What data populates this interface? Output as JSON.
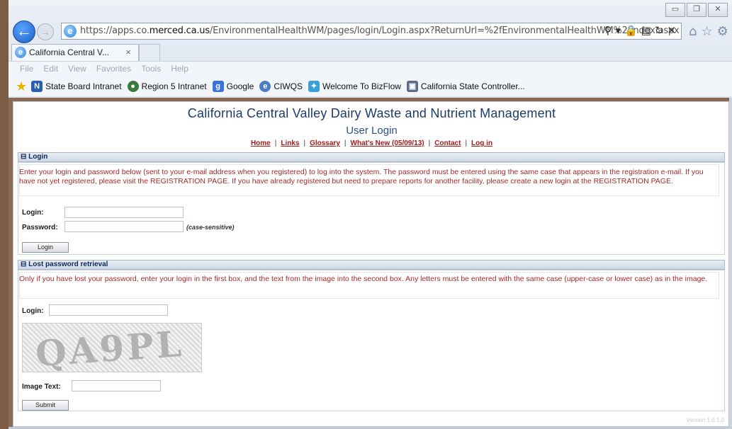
{
  "browser": {
    "url_prefix": "https://apps.co.",
    "url_host": "merced.ca.us",
    "url_path": "/EnvironmentalHealthWM/pages/login/Login.aspx?ReturnUrl=%2fEnvironmentalHealthWM%2findex.aspx",
    "tab_title": "California Central V...",
    "tab_close": "×",
    "menu": [
      "File",
      "Edit",
      "View",
      "Favorites",
      "Tools",
      "Help"
    ],
    "favorites": [
      {
        "label": "State Board Intranet",
        "icon": "state-board-icon",
        "color": "#2a5fb0"
      },
      {
        "label": "Region 5 Intranet",
        "icon": "region5-icon",
        "color": "#3a7a3a"
      },
      {
        "label": "Google",
        "icon": "google-icon",
        "color": "#3b73d8"
      },
      {
        "label": "CIWQS",
        "icon": "ciwqs-icon",
        "color": "#4a7dc8"
      },
      {
        "label": "Welcome To BizFlow",
        "icon": "bizflow-icon",
        "color": "#3aa0d8"
      },
      {
        "label": "California State Controller...",
        "icon": "controller-icon",
        "color": "#5a6a88"
      }
    ]
  },
  "site": {
    "title": "California Central Valley Dairy Waste and Nutrient Management",
    "subtitle": "User Login",
    "nav": {
      "home": "Home",
      "links": "Links",
      "glossary": "Glossary",
      "whats_new": "What's New (05/09/13)",
      "contact": "Contact",
      "login": "Log in"
    }
  },
  "login_section": {
    "header": "Login",
    "message": "Enter your login and password below (sent to your e-mail address when you registered) to log into the system. The password must be entered using the same case that appears in the registration e-mail. If you have not yet registered, please visit the REGISTRATION PAGE. If you have already registered but need to prepare reports for another facility, please create a new login at the REGISTRATION PAGE.",
    "login_label": "Login:",
    "login_value": "",
    "password_label": "Password:",
    "password_value": "",
    "password_hint": "(case-sensitive)",
    "button": "Login"
  },
  "lost_section": {
    "header": "Lost password retrieval",
    "message": "Only if you have lost your password, enter your login in the first box, and the text from the image into the second box. Any letters must be entered with the same case (upper-case or lower case) as in the image.",
    "login_label": "Login:",
    "login_value": "",
    "captcha_text": "QA9PL",
    "image_text_label": "Image Text:",
    "image_text_value": "",
    "button": "Submit"
  },
  "footer": {
    "version": "Version 1.0.1.0"
  }
}
